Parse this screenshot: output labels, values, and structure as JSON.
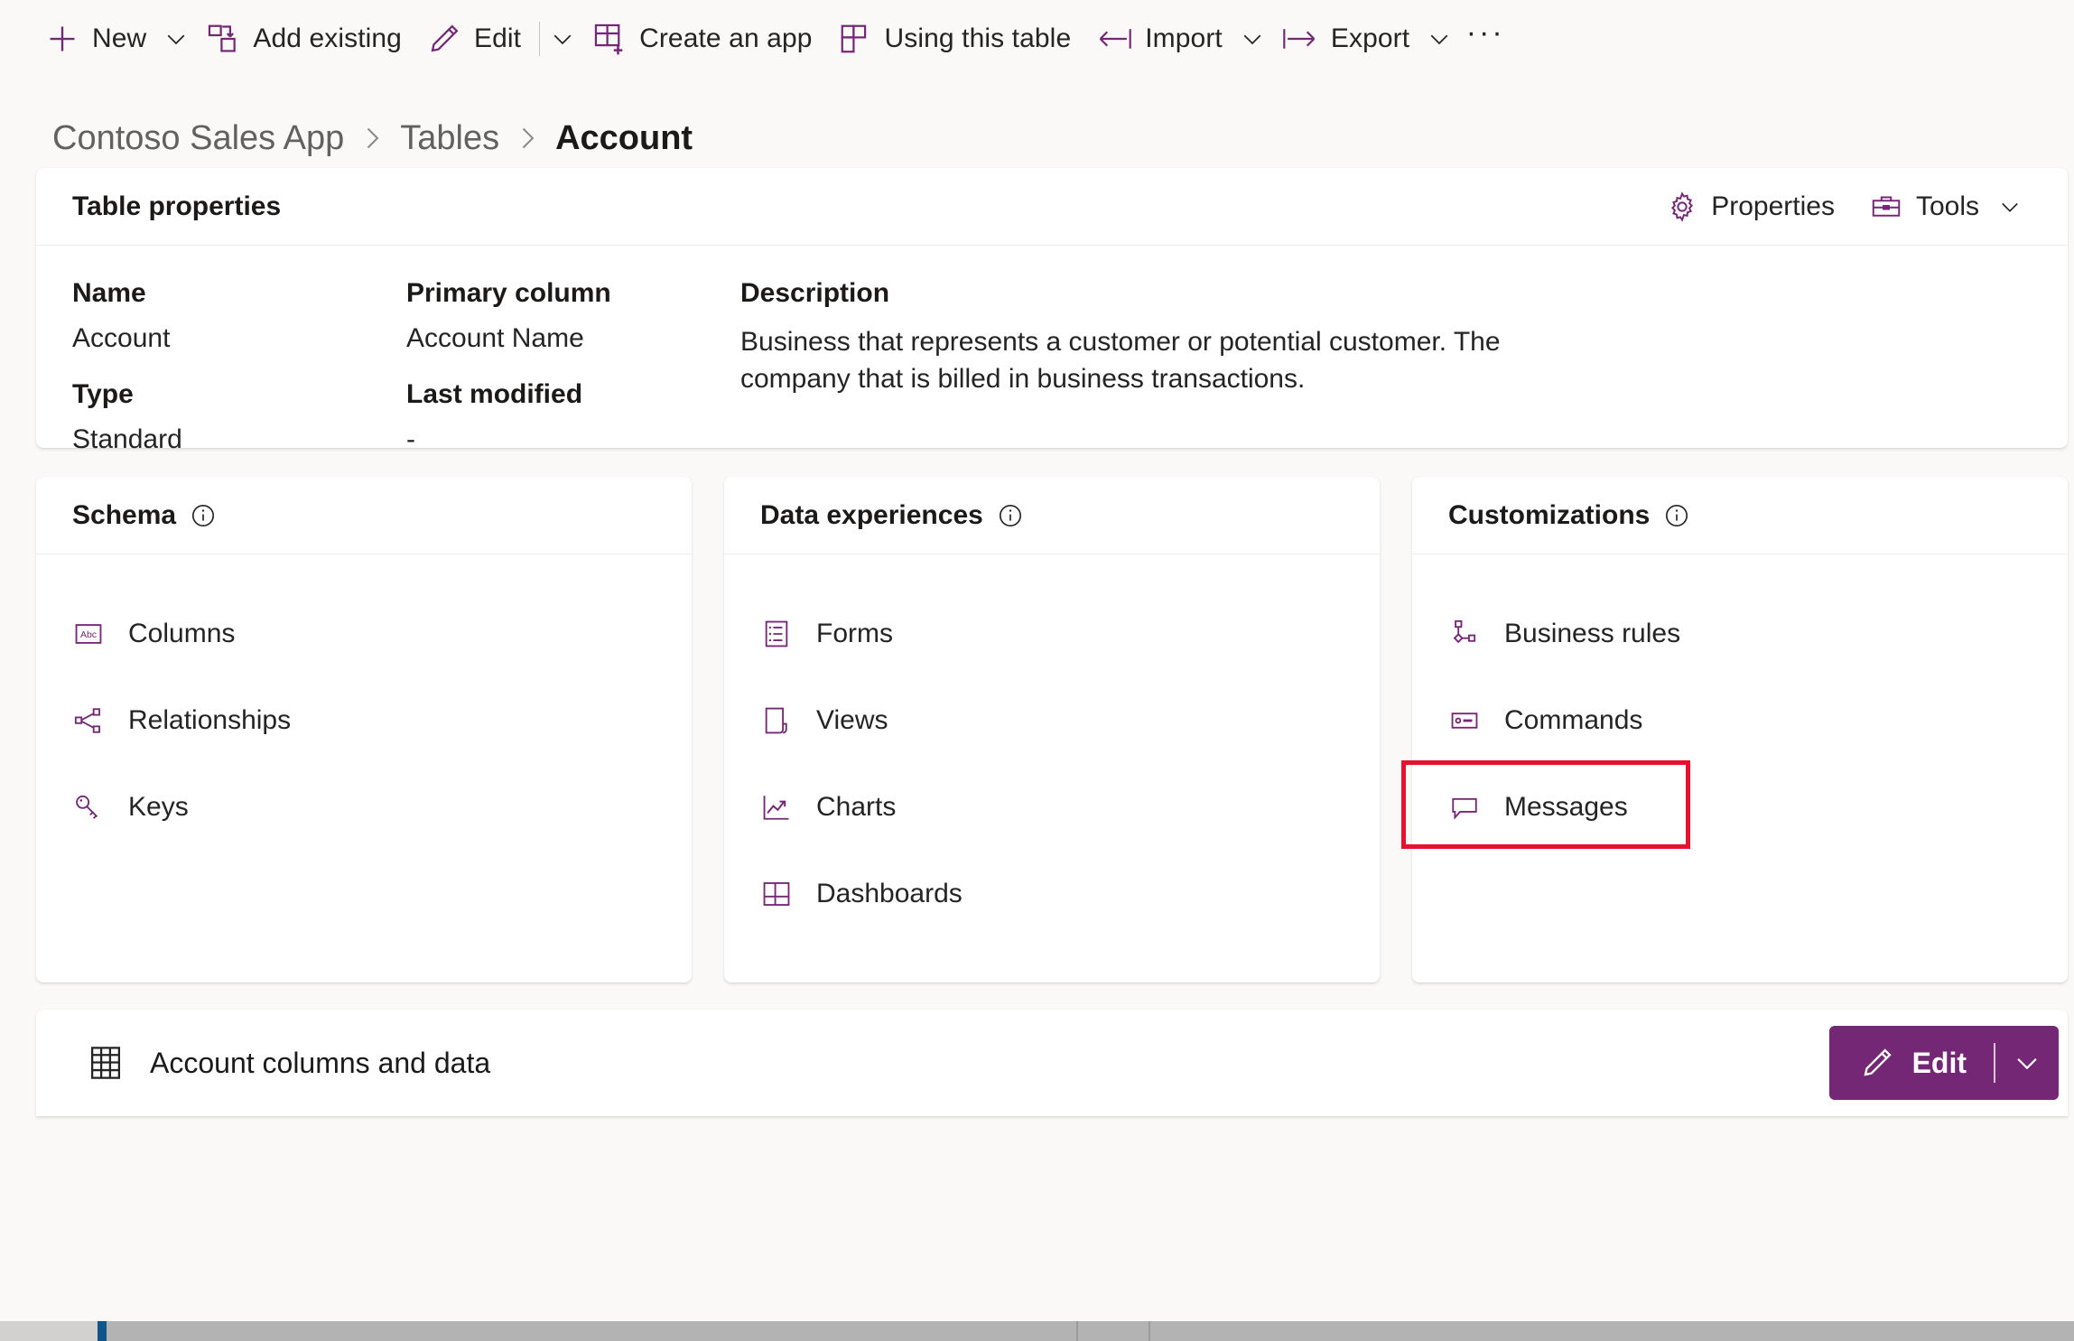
{
  "command_bar": {
    "items": [
      {
        "id": "new",
        "label": "New",
        "icon": "plus-icon",
        "has_chevron": true
      },
      {
        "id": "add-existing",
        "label": "Add existing",
        "icon": "add-existing-icon",
        "has_chevron": false
      },
      {
        "id": "edit",
        "label": "Edit",
        "icon": "pencil-icon",
        "has_chevron": true,
        "has_divider": true
      },
      {
        "id": "create-an-app",
        "label": "Create an app",
        "icon": "create-app-icon",
        "has_chevron": false
      },
      {
        "id": "using-this-table",
        "label": "Using this table",
        "icon": "using-table-icon",
        "has_chevron": false
      },
      {
        "id": "import",
        "label": "Import",
        "icon": "import-arrow-icon",
        "has_chevron": true
      },
      {
        "id": "export",
        "label": "Export",
        "icon": "export-arrow-icon",
        "has_chevron": true
      }
    ],
    "overflow_label": "···"
  },
  "breadcrumb": {
    "items": [
      {
        "label": "Contoso Sales App",
        "current": false
      },
      {
        "label": "Tables",
        "current": false
      },
      {
        "label": "Account",
        "current": true
      }
    ],
    "separator": "›"
  },
  "table_properties": {
    "title": "Table properties",
    "actions": [
      {
        "id": "properties",
        "label": "Properties",
        "icon": "gear-icon",
        "has_chevron": false
      },
      {
        "id": "tools",
        "label": "Tools",
        "icon": "toolbox-icon",
        "has_chevron": true
      }
    ],
    "fields": {
      "name_label": "Name",
      "name_value": "Account",
      "type_label": "Type",
      "type_value": "Standard",
      "primary_column_label": "Primary column",
      "primary_column_value": "Account Name",
      "last_modified_label": "Last modified",
      "last_modified_value": "-",
      "description_label": "Description",
      "description_value": "Business that represents a customer or potential customer. The company that is billed in business transactions."
    }
  },
  "panels": [
    {
      "id": "schema",
      "title": "Schema",
      "info_icon": "info-icon",
      "items": [
        {
          "id": "columns",
          "label": "Columns",
          "icon": "abc-box-icon"
        },
        {
          "id": "relationships",
          "label": "Relationships",
          "icon": "relationships-icon"
        },
        {
          "id": "keys",
          "label": "Keys",
          "icon": "key-icon"
        }
      ]
    },
    {
      "id": "data-experiences",
      "title": "Data experiences",
      "info_icon": "info-icon",
      "items": [
        {
          "id": "forms",
          "label": "Forms",
          "icon": "form-list-icon"
        },
        {
          "id": "views",
          "label": "Views",
          "icon": "view-page-icon"
        },
        {
          "id": "charts",
          "label": "Charts",
          "icon": "line-chart-icon"
        },
        {
          "id": "dashboards",
          "label": "Dashboards",
          "icon": "dashboard-grid-icon"
        }
      ]
    },
    {
      "id": "customizations",
      "title": "Customizations",
      "info_icon": "info-icon",
      "items": [
        {
          "id": "business-rules",
          "label": "Business rules",
          "icon": "business-rules-icon"
        },
        {
          "id": "commands",
          "label": "Commands",
          "icon": "command-bar-icon"
        },
        {
          "id": "messages",
          "label": "Messages",
          "icon": "message-bubble-icon",
          "highlighted": true
        }
      ]
    }
  ],
  "bottom_section": {
    "title": "Account columns and data",
    "icon": "table-grid-icon",
    "edit_button": {
      "label": "Edit",
      "icon": "pencil-icon",
      "chevron": "chevron-down-icon"
    }
  },
  "colors": {
    "accent_purple": "#742774",
    "highlight_red": "#e8112d",
    "page_background": "#faf9f8",
    "card_background": "#ffffff"
  }
}
